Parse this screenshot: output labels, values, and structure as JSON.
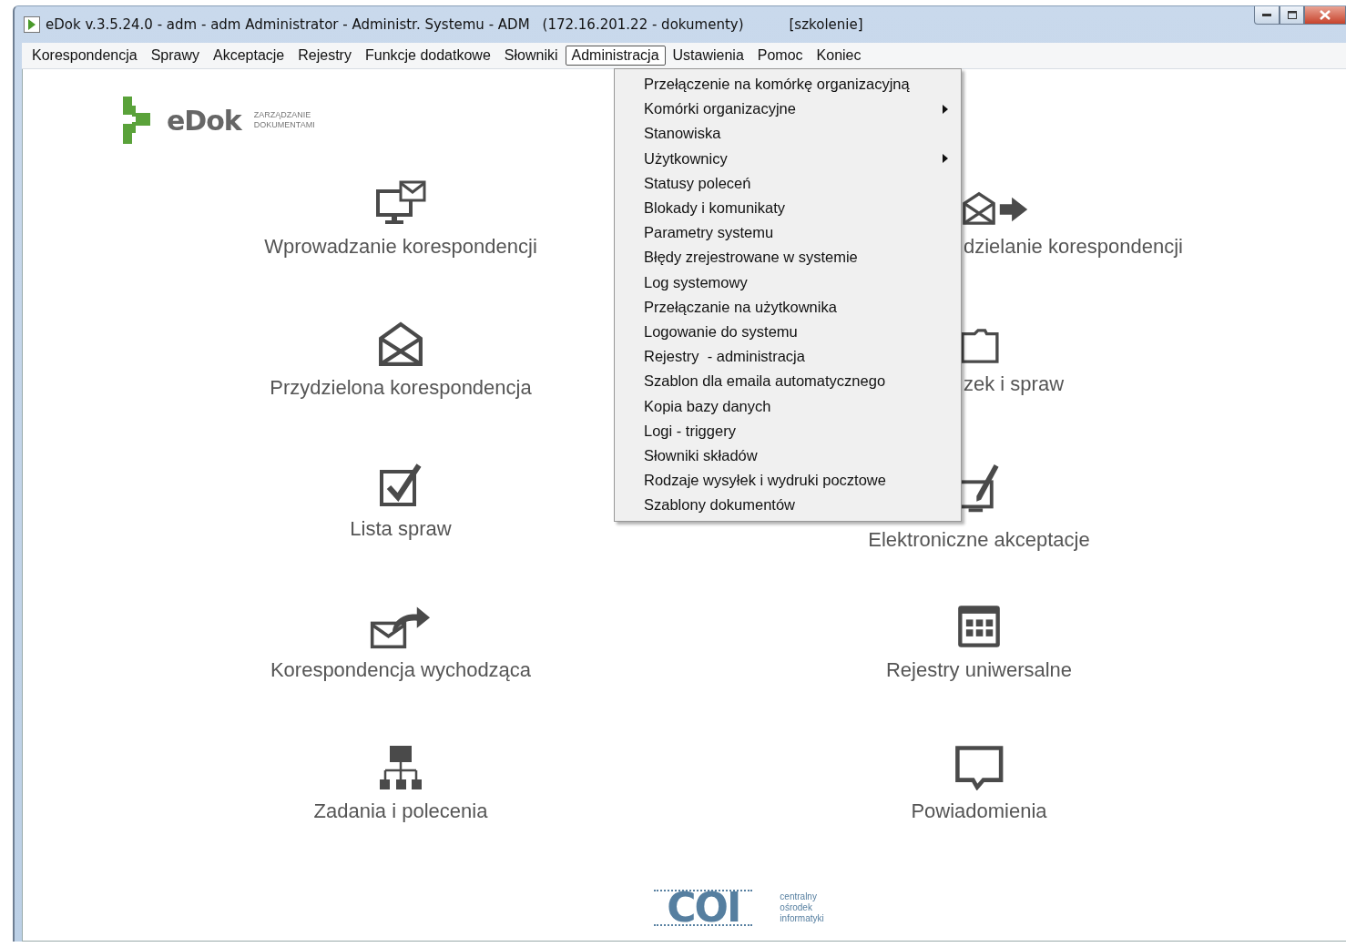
{
  "window": {
    "title": "eDok v.3.5.24.0 - adm - adm Administrator - Administr. Systemu - ADM",
    "title_server": "(172.16.201.22 - dokumenty)",
    "title_env": "[szkolenie]"
  },
  "menu_bar": [
    {
      "label": "Korespondencja",
      "selected": false
    },
    {
      "label": "Sprawy",
      "selected": false
    },
    {
      "label": "Akceptacje",
      "selected": false
    },
    {
      "label": "Rejestry",
      "selected": false
    },
    {
      "label": "Funkcje dodatkowe",
      "selected": false
    },
    {
      "label": "Słowniki",
      "selected": false
    },
    {
      "label": "Administracja",
      "selected": true
    },
    {
      "label": "Ustawienia",
      "selected": false
    },
    {
      "label": "Pomoc",
      "selected": false
    },
    {
      "label": "Koniec",
      "selected": false
    }
  ],
  "dropdown": [
    {
      "label": "Przełączenie na komórkę organizacyjną",
      "submenu": false
    },
    {
      "label": "Komórki organizacyjne",
      "submenu": true
    },
    {
      "label": "Stanowiska",
      "submenu": false
    },
    {
      "label": "Użytkownicy",
      "submenu": true
    },
    {
      "label": "Statusy poleceń",
      "submenu": false
    },
    {
      "label": "Blokady i komunikaty",
      "submenu": false
    },
    {
      "label": "Parametry systemu",
      "submenu": false
    },
    {
      "label": "Błędy zrejestrowane w systemie",
      "submenu": false
    },
    {
      "label": "Log systemowy",
      "submenu": false
    },
    {
      "label": "Przełączanie na użytkownika",
      "submenu": false
    },
    {
      "label": "Logowanie do systemu",
      "submenu": false
    },
    {
      "label": "Rejestry  - administracja",
      "submenu": false
    },
    {
      "label": "Szablon dla emaila automatycznego",
      "submenu": false
    },
    {
      "label": "Kopia bazy danych",
      "submenu": false
    },
    {
      "label": "Logi - triggery",
      "submenu": false
    },
    {
      "label": "Słowniki składów",
      "submenu": false
    },
    {
      "label": "Rodzaje wysyłek i wydruki pocztowe",
      "submenu": false
    },
    {
      "label": "Szablony dokumentów",
      "submenu": false
    }
  ],
  "logo": {
    "name": "eDok",
    "tagline_1": "ZARZĄDZANIE",
    "tagline_2": "DOKUMENTAMI"
  },
  "tiles_left": [
    {
      "label": "Wprowadzanie korespondencji"
    },
    {
      "label": "Przydzielona korespondencja"
    },
    {
      "label": "Lista spraw"
    },
    {
      "label": "Korespondencja wychodząca"
    },
    {
      "label": "Zadania i polecenia"
    }
  ],
  "tiles_right": [
    {
      "label": "dzielanie korespondencji",
      "kind": "covered"
    },
    {
      "label": "zek i spraw",
      "kind": "covered"
    },
    {
      "label": "Elektroniczne akceptacje",
      "kind": "full"
    },
    {
      "label": "Rejestry uniwersalne",
      "kind": "full"
    },
    {
      "label": "Powiadomienia",
      "kind": "full"
    }
  ],
  "footer_logo": {
    "mark": "COI",
    "line_1": "centralny",
    "line_2": "ośrodek",
    "line_3": "informatyki"
  }
}
